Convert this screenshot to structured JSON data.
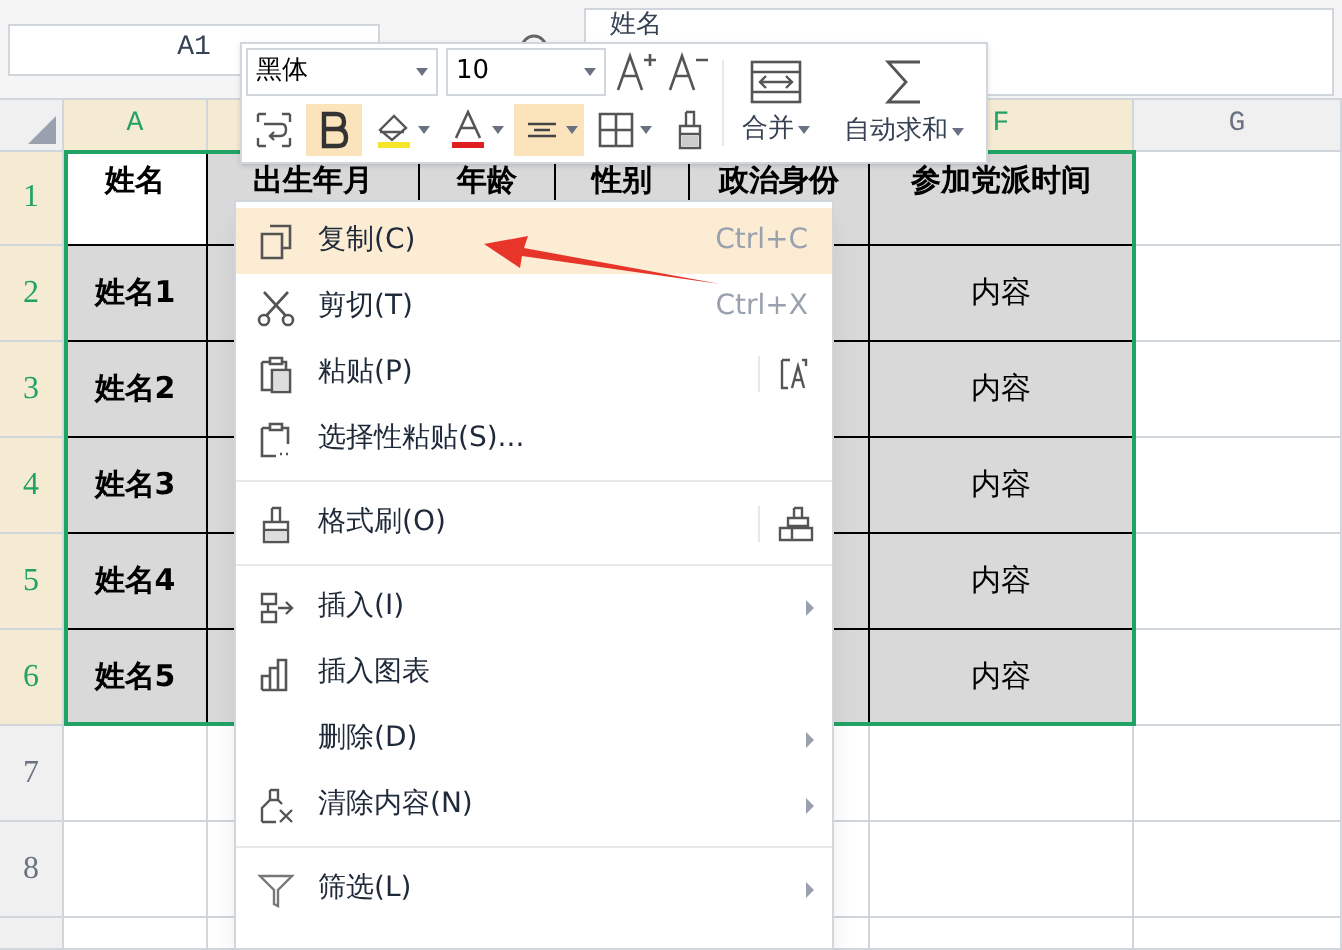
{
  "name_box": "A1",
  "formula_bar": {
    "value": "姓名"
  },
  "columns": [
    {
      "label": "A",
      "selected": true
    },
    {
      "selected": true
    },
    null,
    null,
    null,
    {
      "label": "F",
      "selected": true
    },
    {
      "label": "G",
      "selected": false
    }
  ],
  "rows": [
    {
      "number": "1",
      "selected": true,
      "cells": [
        {
          "text": "姓名",
          "bold": true,
          "shaded": false
        },
        {
          "text": "出生年月",
          "bold": true,
          "shaded": true
        },
        {
          "text": "年龄",
          "bold": true,
          "shaded": true
        },
        {
          "text": "性别",
          "bold": true,
          "shaded": true
        },
        {
          "text": "政治身份",
          "bold": true,
          "shaded": true
        },
        {
          "text": "参加党派时间",
          "bold": true,
          "shaded": true
        }
      ]
    },
    {
      "number": "2",
      "selected": true,
      "cells": [
        {
          "text": "姓名1",
          "bold": true,
          "shaded": true
        },
        {
          "shaded": true
        },
        null,
        null,
        {
          "shaded": true
        },
        {
          "text": "内容",
          "bold": false,
          "shaded": true
        }
      ]
    },
    {
      "number": "3",
      "selected": true,
      "cells": [
        {
          "text": "姓名2",
          "bold": true,
          "shaded": true
        },
        {
          "shaded": true
        },
        null,
        null,
        {
          "shaded": true
        },
        {
          "text": "内容",
          "bold": false,
          "shaded": true
        }
      ]
    },
    {
      "number": "4",
      "selected": true,
      "cells": [
        {
          "text": "姓名3",
          "bold": true,
          "shaded": true
        },
        {
          "shaded": true
        },
        null,
        null,
        {
          "shaded": true
        },
        {
          "text": "内容",
          "bold": false,
          "shaded": true
        }
      ]
    },
    {
      "number": "5",
      "selected": true,
      "cells": [
        {
          "text": "姓名4",
          "bold": true,
          "shaded": true
        },
        {
          "shaded": true
        },
        null,
        null,
        {
          "shaded": true
        },
        {
          "text": "内容",
          "bold": false,
          "shaded": true
        }
      ]
    },
    {
      "number": "6",
      "selected": true,
      "cells": [
        {
          "text": "姓名5",
          "bold": true,
          "shaded": true
        },
        {
          "shaded": true
        },
        null,
        null,
        {
          "shaded": true
        },
        {
          "text": "内容",
          "bold": false,
          "shaded": true
        }
      ]
    },
    {
      "number": "7",
      "selected": false
    },
    {
      "number": "8",
      "selected": false
    },
    {
      "selected": false
    }
  ],
  "toolbar": {
    "font": "黑体",
    "size": "10",
    "buttons": [
      {
        "selected": false,
        "dropdown": false
      },
      {
        "selected": true,
        "dropdown": false
      },
      {
        "selected": false,
        "dropdown": true
      },
      {
        "selected": false,
        "dropdown": true
      },
      {
        "selected": true,
        "dropdown": true
      },
      {
        "selected": false,
        "dropdown": true
      },
      {
        "selected": false,
        "dropdown": false
      }
    ],
    "merge": "合并",
    "autosum": "自动求和"
  },
  "context_menu": [
    {
      "kind": "item",
      "label": "复制(C)",
      "shortcut": "Ctrl+C",
      "selected": true,
      "submenu": false
    },
    {
      "kind": "item",
      "label": "剪切(T)",
      "shortcut": "Ctrl+X",
      "selected": false,
      "submenu": false
    },
    {
      "kind": "item",
      "label": "粘贴(P)",
      "selected": false,
      "submenu": false
    },
    {
      "kind": "item",
      "label": "选择性粘贴(S)...",
      "selected": false,
      "submenu": false
    },
    {
      "kind": "separator"
    },
    {
      "kind": "item",
      "label": "格式刷(O)",
      "selected": false,
      "submenu": false
    },
    {
      "kind": "separator"
    },
    {
      "kind": "item",
      "label": "插入(I)",
      "selected": false,
      "submenu": true
    },
    {
      "kind": "item",
      "label": "插入图表",
      "selected": false,
      "submenu": false
    },
    {
      "kind": "item",
      "label": "删除(D)",
      "selected": false,
      "submenu": true
    },
    {
      "kind": "item",
      "label": "清除内容(N)",
      "selected": false,
      "submenu": true
    },
    {
      "kind": "separator"
    },
    {
      "kind": "item",
      "label": "筛选(L)",
      "selected": false,
      "submenu": true
    }
  ]
}
